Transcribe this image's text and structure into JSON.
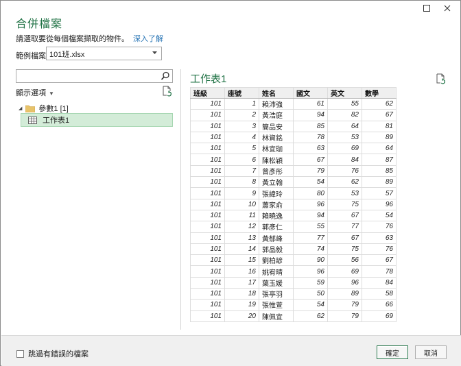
{
  "window": {
    "title": "合併檔案",
    "description": "請選取要從每個檔案擷取的物件。",
    "learn_more": "深入了解"
  },
  "sample": {
    "label": "範例檔案:",
    "value": "101班.xlsx"
  },
  "navigator": {
    "search_placeholder": "",
    "display_options": "顯示選項",
    "folder_label": "參數1 [1]",
    "sheet_label": "工作表1"
  },
  "preview": {
    "title": "工作表1",
    "columns": [
      "班級",
      "座號",
      "姓名",
      "國文",
      "英文",
      "數學"
    ],
    "rows": [
      [
        "101",
        "1",
        "賴沛強",
        "61",
        "55",
        "62"
      ],
      [
        "101",
        "2",
        "黃浩庭",
        "94",
        "82",
        "67"
      ],
      [
        "101",
        "3",
        "簡品安",
        "85",
        "64",
        "81"
      ],
      [
        "101",
        "4",
        "林資銘",
        "78",
        "53",
        "89"
      ],
      [
        "101",
        "5",
        "林宜珈",
        "63",
        "69",
        "64"
      ],
      [
        "101",
        "6",
        "陳松穎",
        "67",
        "84",
        "87"
      ],
      [
        "101",
        "7",
        "曾彥彤",
        "79",
        "76",
        "85"
      ],
      [
        "101",
        "8",
        "黃立翰",
        "54",
        "62",
        "89"
      ],
      [
        "101",
        "9",
        "張緯玲",
        "80",
        "53",
        "57"
      ],
      [
        "101",
        "10",
        "蕭家俞",
        "96",
        "75",
        "96"
      ],
      [
        "101",
        "11",
        "賴曉逸",
        "94",
        "67",
        "54"
      ],
      [
        "101",
        "12",
        "郭彥仁",
        "55",
        "77",
        "76"
      ],
      [
        "101",
        "13",
        "黃郁峰",
        "77",
        "67",
        "63"
      ],
      [
        "101",
        "14",
        "郭品毅",
        "74",
        "75",
        "76"
      ],
      [
        "101",
        "15",
        "劉柏諺",
        "90",
        "56",
        "67"
      ],
      [
        "101",
        "16",
        "姚宥晴",
        "96",
        "69",
        "78"
      ],
      [
        "101",
        "17",
        "葉玉媛",
        "59",
        "96",
        "84"
      ],
      [
        "101",
        "18",
        "張亭羽",
        "50",
        "89",
        "58"
      ],
      [
        "101",
        "19",
        "張惟萱",
        "54",
        "79",
        "66"
      ],
      [
        "101",
        "20",
        "陳佩宜",
        "62",
        "79",
        "69"
      ]
    ]
  },
  "footer": {
    "skip_errors_label": "跳過有錯誤的檔案",
    "ok_label": "確定",
    "cancel_label": "取消"
  },
  "colors": {
    "accent": "#217346",
    "selection": "#d3ecd8",
    "link": "#1f6fb2"
  }
}
